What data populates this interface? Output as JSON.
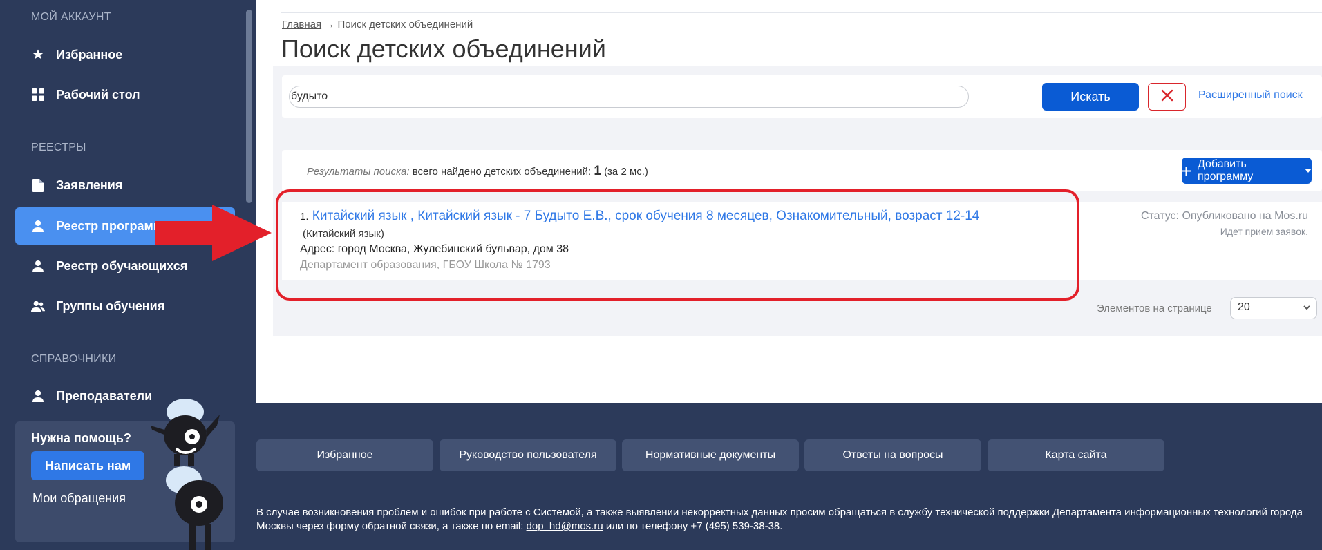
{
  "sidebar": {
    "section_account": "МОЙ АККАУНТ",
    "section_registries": "РЕЕСТРЫ",
    "section_refs": "СПРАВОЧНИКИ",
    "items": [
      {
        "label": "Избранное",
        "icon": "star-icon"
      },
      {
        "label": "Рабочий стол",
        "icon": "grid-icon"
      },
      {
        "label": "Заявления",
        "icon": "document-icon"
      },
      {
        "label": "Реестр программ",
        "icon": "user-icon"
      },
      {
        "label": "Реестр обучающихся",
        "icon": "user-icon"
      },
      {
        "label": "Группы обучения",
        "icon": "users-icon"
      },
      {
        "label": "Преподаватели",
        "icon": "user-icon"
      }
    ],
    "help": {
      "title": "Нужна помощь?",
      "button": "Написать нам",
      "link": "Мои обращения"
    }
  },
  "breadcrumb": {
    "home": "Главная",
    "sep": "→",
    "current": "Поиск детских объединений"
  },
  "page_title": "Поиск детских объединений",
  "search": {
    "value": "будыто",
    "button": "Искать",
    "advanced": "Расширенный поиск"
  },
  "results": {
    "label": "Результаты поиска:",
    "text": "всего найдено детских объединений:",
    "count": "1",
    "time": "(за 2 мс.)",
    "add_button": "Добавить программу"
  },
  "result_item": {
    "number": "1.",
    "title": "Китайский язык , Китайский язык - 7 Будыто Е.В., срок обучения 8 месяцев, Ознакомительный, возраст 12-14",
    "subtitle": "(Китайский язык)",
    "address": "Адрес: город Москва, Жулебинский бульвар, дом 38",
    "department": "Департамент образования, ГБОУ Школа № 1793",
    "status": "Статус: Опубликовано на Mos.ru",
    "status_sub": "Идет прием заявок."
  },
  "pagination": {
    "label": "Элементов на странице",
    "value": "20"
  },
  "footer": {
    "buttons": [
      "Избранное",
      "Руководство пользователя",
      "Нормативные документы",
      "Ответы на вопросы",
      "Карта сайта"
    ],
    "text_part1": "В случае возникновения проблем и ошибок при работе с Системой, а также выявлении некорректных данных просим обращаться в службу технической поддержки Департамента информационных технологий города Москвы через форму обратной связи, а также по email:",
    "email": "dop_hd@mos.ru",
    "text_part2": "или по телефону +7 (495) 539-38-38."
  },
  "colors": {
    "sidebar_bg": "#2c3a5a",
    "accent": "#0a5bd4",
    "active_item": "#4a90f0",
    "highlight": "#e3202a"
  }
}
